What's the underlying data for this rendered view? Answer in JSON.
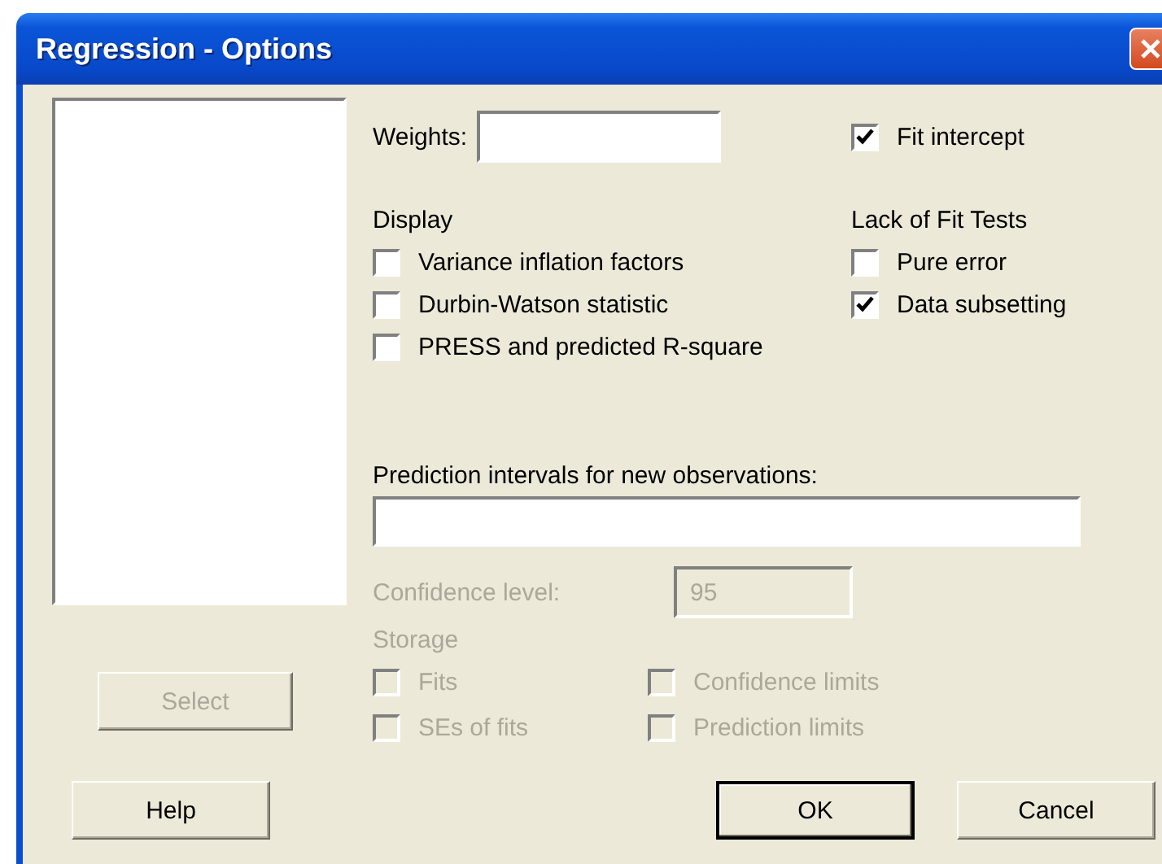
{
  "window": {
    "title": "Regression - Options"
  },
  "weights": {
    "label": "Weights:"
  },
  "fit_intercept": {
    "label": "Fit intercept",
    "checked": true
  },
  "display": {
    "title": "Display",
    "options": [
      {
        "label": "Variance inflation factors",
        "checked": false
      },
      {
        "label": "Durbin-Watson statistic",
        "checked": false
      },
      {
        "label": "PRESS and predicted R-square",
        "checked": false
      }
    ]
  },
  "lack_of_fit": {
    "title": "Lack of Fit Tests",
    "options": [
      {
        "label": "Pure error",
        "checked": false
      },
      {
        "label": "Data subsetting",
        "checked": true
      }
    ]
  },
  "prediction": {
    "label": "Prediction intervals for new observations:"
  },
  "confidence": {
    "label": "Confidence level:",
    "value": "95",
    "disabled": true
  },
  "storage": {
    "title": "Storage",
    "disabled": true,
    "options": [
      {
        "label": "Fits",
        "checked": false
      },
      {
        "label": "SEs of fits",
        "checked": false
      },
      {
        "label": "Confidence limits",
        "checked": false
      },
      {
        "label": "Prediction limits",
        "checked": false
      }
    ]
  },
  "select_button": {
    "label": "Select",
    "disabled": true
  },
  "buttons": [
    {
      "label": "Help",
      "default": false
    },
    {
      "label": "OK",
      "default": true
    },
    {
      "label": "Cancel",
      "default": false
    }
  ]
}
